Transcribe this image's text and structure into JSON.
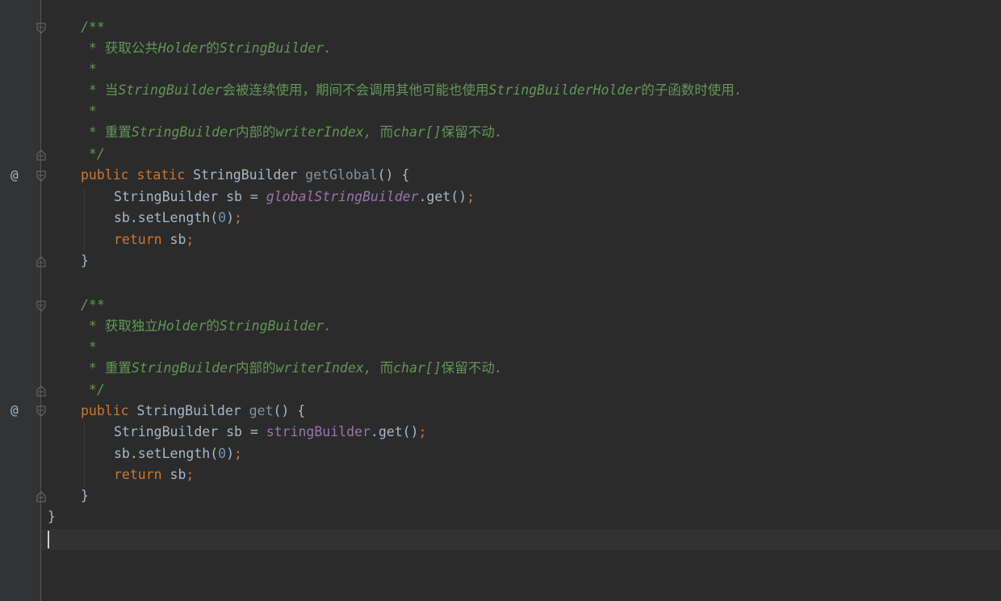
{
  "colors": {
    "background": "#2b2b2b",
    "gutter": "#313335",
    "comment": "#629755",
    "keyword": "#cc7832",
    "field": "#9876aa",
    "number": "#6897bb",
    "text": "#a9b7c6"
  },
  "gutter": {
    "override_marker_1": "@",
    "override_marker_2": "@"
  },
  "code": {
    "doc1_open": "/**",
    "doc1_l1_a": " * ",
    "doc1_l1_b": "获取公共",
    "doc1_l1_c": "Holder",
    "doc1_l1_d": "的",
    "doc1_l1_e": "StringBuilder.",
    "doc1_l2": " *",
    "doc1_l3_a": " * ",
    "doc1_l3_b": "当",
    "doc1_l3_c": "StringBuilder",
    "doc1_l3_d": "会被连续使用，期间不会调用其他可能也使用",
    "doc1_l3_e": "StringBuilderHolder",
    "doc1_l3_f": "的子函数时使用",
    "doc1_l3_g": ".",
    "doc1_l4": " *",
    "doc1_l5_a": " * ",
    "doc1_l5_b": "重置",
    "doc1_l5_c": "StringBuilder",
    "doc1_l5_d": "内部的",
    "doc1_l5_e": "writerIndex, ",
    "doc1_l5_f": "而",
    "doc1_l5_g": "char[]",
    "doc1_l5_h": "保留不动",
    "doc1_l5_i": ".",
    "doc1_close": " */",
    "m1_kw1": "public",
    "m1_kw2": "static",
    "m1_type": "StringBuilder",
    "m1_name": "getGlobal",
    "m1_sig_end": "() {",
    "m1_l1_a": "StringBuilder sb = ",
    "m1_l1_field": "globalStringBuilder",
    "m1_l1_b": ".get()",
    "semicolon": ";",
    "setlen_a": "sb.setLength(",
    "zero": "0",
    "setlen_b": ")",
    "return_kw": "return",
    "return_rest": " sb",
    "close_brace": "}",
    "doc2_open": "/**",
    "doc2_l1_a": " * ",
    "doc2_l1_b": "获取独立",
    "doc2_l1_c": "Holder",
    "doc2_l1_d": "的",
    "doc2_l1_e": "StringBuilder.",
    "doc2_l2": " *",
    "doc2_l3_a": " * ",
    "doc2_l3_b": "重置",
    "doc2_l3_c": "StringBuilder",
    "doc2_l3_d": "内部的",
    "doc2_l3_e": "writerIndex, ",
    "doc2_l3_f": "而",
    "doc2_l3_g": "char[]",
    "doc2_l3_h": "保留不动",
    "doc2_l3_i": ".",
    "doc2_close": " */",
    "m2_kw1": "public",
    "m2_type": "StringBuilder",
    "m2_name": "get",
    "m2_sig_end": "() {",
    "m2_l1_a": "StringBuilder sb = ",
    "m2_l1_field": "stringBuilder",
    "m2_l1_b": ".get()",
    "class_close": "}"
  }
}
